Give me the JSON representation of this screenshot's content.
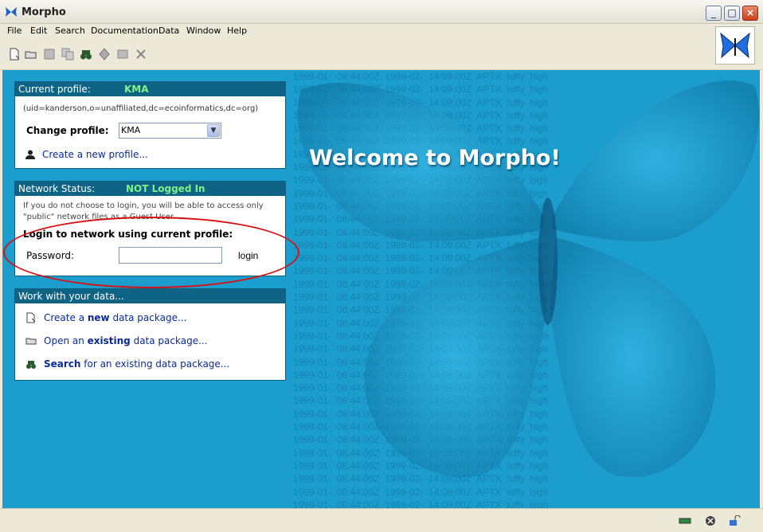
{
  "window": {
    "title": "Morpho"
  },
  "menu": [
    "File",
    "Edit",
    "Search",
    "Documentation",
    "Data",
    "Window",
    "Help"
  ],
  "welcome": "Welcome to Morpho!",
  "profile_panel": {
    "header_label": "Current profile:",
    "profile_name": "KMA",
    "uid": "(uid=kanderson,o=unaffiliated,dc=ecoinformatics,dc=org)",
    "change_label": "Change profile:",
    "selected": "KMA",
    "create_link": "Create a new profile..."
  },
  "network_panel": {
    "header_label": "Network Status:",
    "status": "NOT Logged In",
    "info": "If you do not choose to login, you will be able to access only \"public\" network files as a Guest User.",
    "login_heading": "Login to network using current profile:",
    "password_label": "Password:",
    "password_value": "",
    "login_button": "login"
  },
  "data_panel": {
    "header_label": "Work with your data...",
    "create_pre": "Create a ",
    "create_bold": "new",
    "create_post": " data package...",
    "open_pre": "Open an ",
    "open_bold": "existing",
    "open_post": " data package...",
    "search_bold": "Search",
    "search_post": " for an existing data package..."
  },
  "colors": {
    "accent": "#1b9ecd",
    "header": "#0f6385",
    "highlight": "#7ff08a",
    "annotation": "#d81010"
  }
}
